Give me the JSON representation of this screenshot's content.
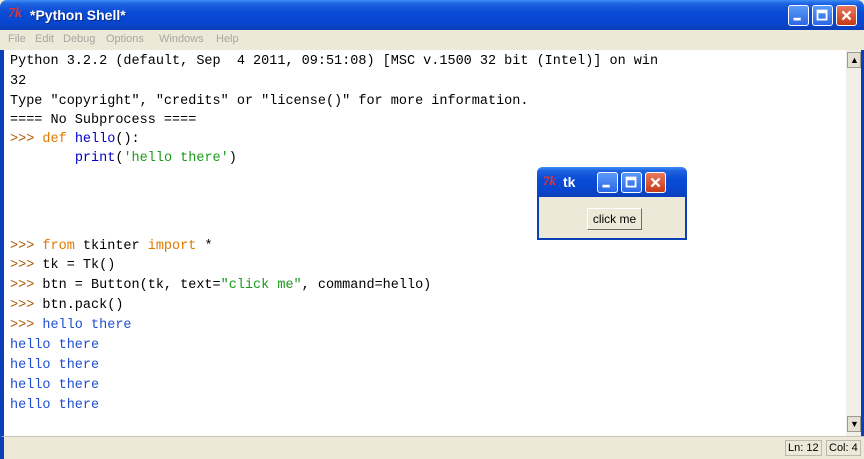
{
  "window": {
    "logo": "7k",
    "title": "*Python Shell*",
    "minimize": "_",
    "maximize": "□",
    "close": "✕"
  },
  "menu": [
    "File",
    "Edit",
    "Debug",
    "Options",
    "Windows",
    "Help"
  ],
  "shell": {
    "banner1": "Python 3.2.2 (default, Sep  4 2011, 09:51:08) [MSC v.1500 32 bit (Intel)] on win",
    "banner2": "32",
    "banner3": "Type \"copyright\", \"credits\" or \"license()\" for more information.",
    "banner4": "==== No Subprocess ====",
    "prompt": ">>> ",
    "def_kw": "def",
    "def_name": "hello",
    "def_rest": "():",
    "print_indent": "        ",
    "print_fn": "print",
    "print_open": "(",
    "print_str": "'hello there'",
    "print_close": ")",
    "from_kw": "from",
    "from_mod": " tkinter ",
    "import_kw": "import",
    "import_rest": " *",
    "line_tk": "tk = Tk()",
    "btn_pre": "btn = Button(tk, text=",
    "btn_str": "\"click me\"",
    "btn_post": ", command=hello)",
    "line_pack": "btn.pack()",
    "output": [
      "hello there",
      "hello there",
      "hello there",
      "hello there",
      "hello there"
    ]
  },
  "statusbar": {
    "line": "Ln: 12",
    "col": "Col: 4"
  },
  "tk_window": {
    "logo": "7k",
    "title": "tk",
    "button_label": "click me"
  },
  "colors": {
    "titlebar": "#0846cf",
    "close": "#c53a17",
    "prompt": "#b05a00",
    "keyword": "#e07a00",
    "string": "#1a9a1a",
    "output": "#1f4fd0"
  }
}
